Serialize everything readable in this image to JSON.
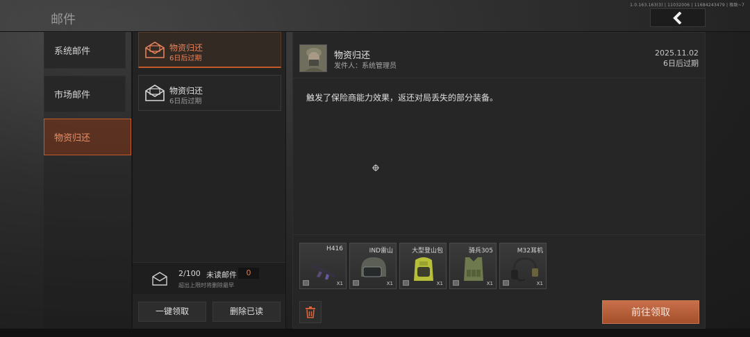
{
  "header": {
    "title": "邮件",
    "version": "1.0.163.163(3) | 11032006 | 11684243479 | 极致~7",
    "back_icon": "chevron-left-icon"
  },
  "categories": [
    {
      "label": "系统邮件",
      "active": false
    },
    {
      "label": "市场邮件",
      "active": false
    },
    {
      "label": "物资归还",
      "active": true
    }
  ],
  "mails": [
    {
      "title": "物资归还",
      "sub": "6日后过期",
      "active": true,
      "icon": "envelope-open-icon"
    },
    {
      "title": "物资归还",
      "sub": "6日后过期",
      "active": false,
      "icon": "envelope-open-icon"
    }
  ],
  "counter": {
    "count": "2/100",
    "label": "未读邮件",
    "unread": "0",
    "hint": "超出上限时将删除最早"
  },
  "actions": {
    "claim_all": "一键领取",
    "delete_read": "删除已读"
  },
  "detail": {
    "title": "物资归还",
    "sender": "发件人：系统管理员",
    "date": "2025.11.02",
    "expire": "6日后过期",
    "body": "触发了保险商能力效果，返还对局丢失的部分装备。"
  },
  "items": [
    {
      "name": "H416",
      "qty": "X1",
      "icon": "rifle-icon"
    },
    {
      "name": "IND雷山",
      "qty": "X1",
      "icon": "helmet-icon"
    },
    {
      "name": "大型登山包",
      "qty": "X1",
      "icon": "backpack-icon"
    },
    {
      "name": "骑兵305",
      "qty": "X1",
      "icon": "armor-vest-icon"
    },
    {
      "name": "M32耳机",
      "qty": "X1",
      "icon": "headset-icon"
    }
  ],
  "footer": {
    "claim_label": "前往领取"
  },
  "colors": {
    "accent": "#c45a2a",
    "accent_text": "#e8825a",
    "button": "#b45d38"
  }
}
